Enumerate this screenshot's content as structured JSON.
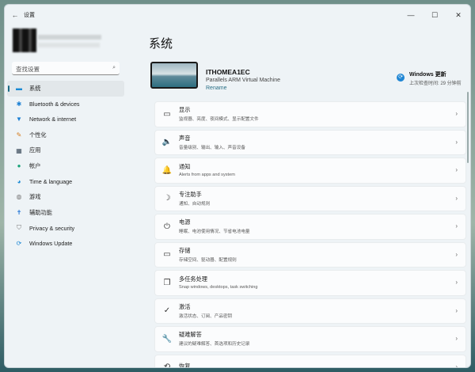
{
  "titlebar": {
    "title": "设置",
    "back": "←",
    "minimize": "—",
    "maximize": "☐",
    "close": "✕"
  },
  "search": {
    "placeholder": "查找设置",
    "icon": "search-icon"
  },
  "sidebar": {
    "items": [
      {
        "label": "系统",
        "icon": "▬",
        "color": "#1a8ad4"
      },
      {
        "label": "Bluetooth & devices",
        "icon": "✱",
        "color": "#1a7fd4"
      },
      {
        "label": "Network & internet",
        "icon": "▼",
        "color": "#1a7fd4"
      },
      {
        "label": "个性化",
        "icon": "✎",
        "color": "#d47a1a"
      },
      {
        "label": "应用",
        "icon": "▦",
        "color": "#3a4a5a"
      },
      {
        "label": "帐户",
        "icon": "●",
        "color": "#1aa37a"
      },
      {
        "label": "Time & language",
        "icon": "◕",
        "color": "#1a8ad4"
      },
      {
        "label": "游戏",
        "icon": "◍",
        "color": "#777"
      },
      {
        "label": "辅助功能",
        "icon": "✝",
        "color": "#1a6fd4"
      },
      {
        "label": "Privacy & security",
        "icon": "⛉",
        "color": "#777"
      },
      {
        "label": "Windows Update",
        "icon": "⟳",
        "color": "#1a86d4"
      }
    ]
  },
  "main": {
    "title": "系统",
    "device": {
      "name": "ITHOMEA1EC",
      "model": "Parallels ARM Virtual Machine",
      "rename": "Rename"
    },
    "update": {
      "title": "Windows 更新",
      "status": "上次检查时间: 29 分钟前"
    },
    "cards": [
      {
        "title": "显示",
        "subtitle": "监视器、亮度、夜间模式、显示配置文件",
        "icon": "▭"
      },
      {
        "title": "声音",
        "subtitle": "音量级别、输出、输入、声音设备",
        "icon": "🔈"
      },
      {
        "title": "通知",
        "subtitle": "Alerts from apps and system",
        "icon": "🔔"
      },
      {
        "title": "专注助手",
        "subtitle": "通知、自动规则",
        "icon": "☽"
      },
      {
        "title": "电源",
        "subtitle": "睡眠、电池使用情况、节省电池电量",
        "icon": "⏻"
      },
      {
        "title": "存储",
        "subtitle": "存储空间、驱动器、配置规则",
        "icon": "▭"
      },
      {
        "title": "多任务处理",
        "subtitle": "Snap windows, desktops, task switching",
        "icon": "❐"
      },
      {
        "title": "激活",
        "subtitle": "激活状态、订阅、产品密钥",
        "icon": "✓"
      },
      {
        "title": "疑难解答",
        "subtitle": "建议的疑难解答、首选项和历史记录",
        "icon": "🔧"
      },
      {
        "title": "恢复",
        "subtitle": "",
        "icon": "⟲"
      }
    ]
  }
}
